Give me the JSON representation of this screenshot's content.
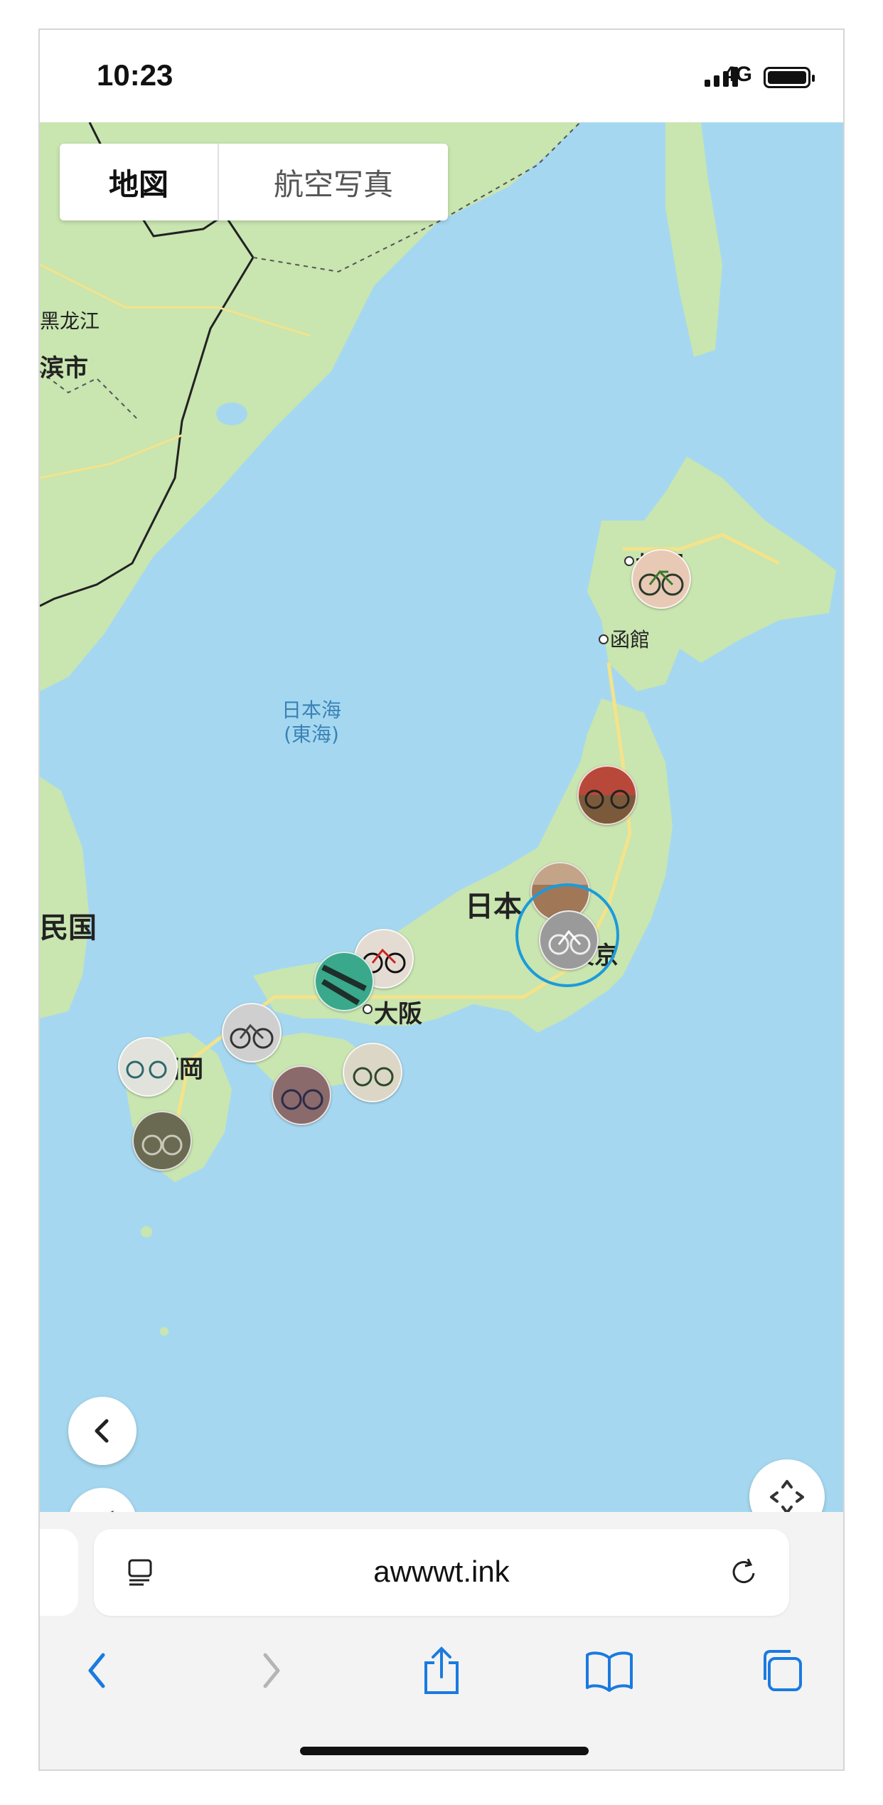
{
  "status_bar": {
    "time": "10:23",
    "network": "4G",
    "icons": [
      "signal-icon",
      "battery-icon"
    ]
  },
  "map_type": {
    "options": [
      "地図",
      "航空写真"
    ],
    "selected": "地図"
  },
  "map": {
    "labels": {
      "heilongjiang": "黑龙江",
      "harbin": "滨市",
      "sapporo": "札幌",
      "hakodate": "函館",
      "sea_of_japan": "日本海",
      "sea_of_japan_alt": "(東海)",
      "japan": "日本",
      "tokyo": "東京",
      "osaka": "大阪",
      "fukuoka": "福岡",
      "korea": "民国"
    },
    "photo_markers": [
      "bicycle-photo",
      "bicycle-photo",
      "bicycle-photo",
      "bicycle-photo",
      "bicycle-photo",
      "bicycle-photo",
      "bicycle-photo",
      "bicycle-photo",
      "bicycle-photo",
      "bicycle-photo",
      "bicycle-photo"
    ],
    "controls": [
      "back-chevron-icon",
      "location-arrow-icon",
      "recenter-arrows-icon"
    ]
  },
  "browser": {
    "url": "awwwt.ink",
    "icons": [
      "reader-icon",
      "reload-icon",
      "back-icon",
      "forward-icon",
      "share-icon",
      "bookmarks-icon",
      "tabs-icon"
    ],
    "colors": {
      "accent": "#1a7ae0",
      "disabled": "#b5b5b5"
    }
  }
}
